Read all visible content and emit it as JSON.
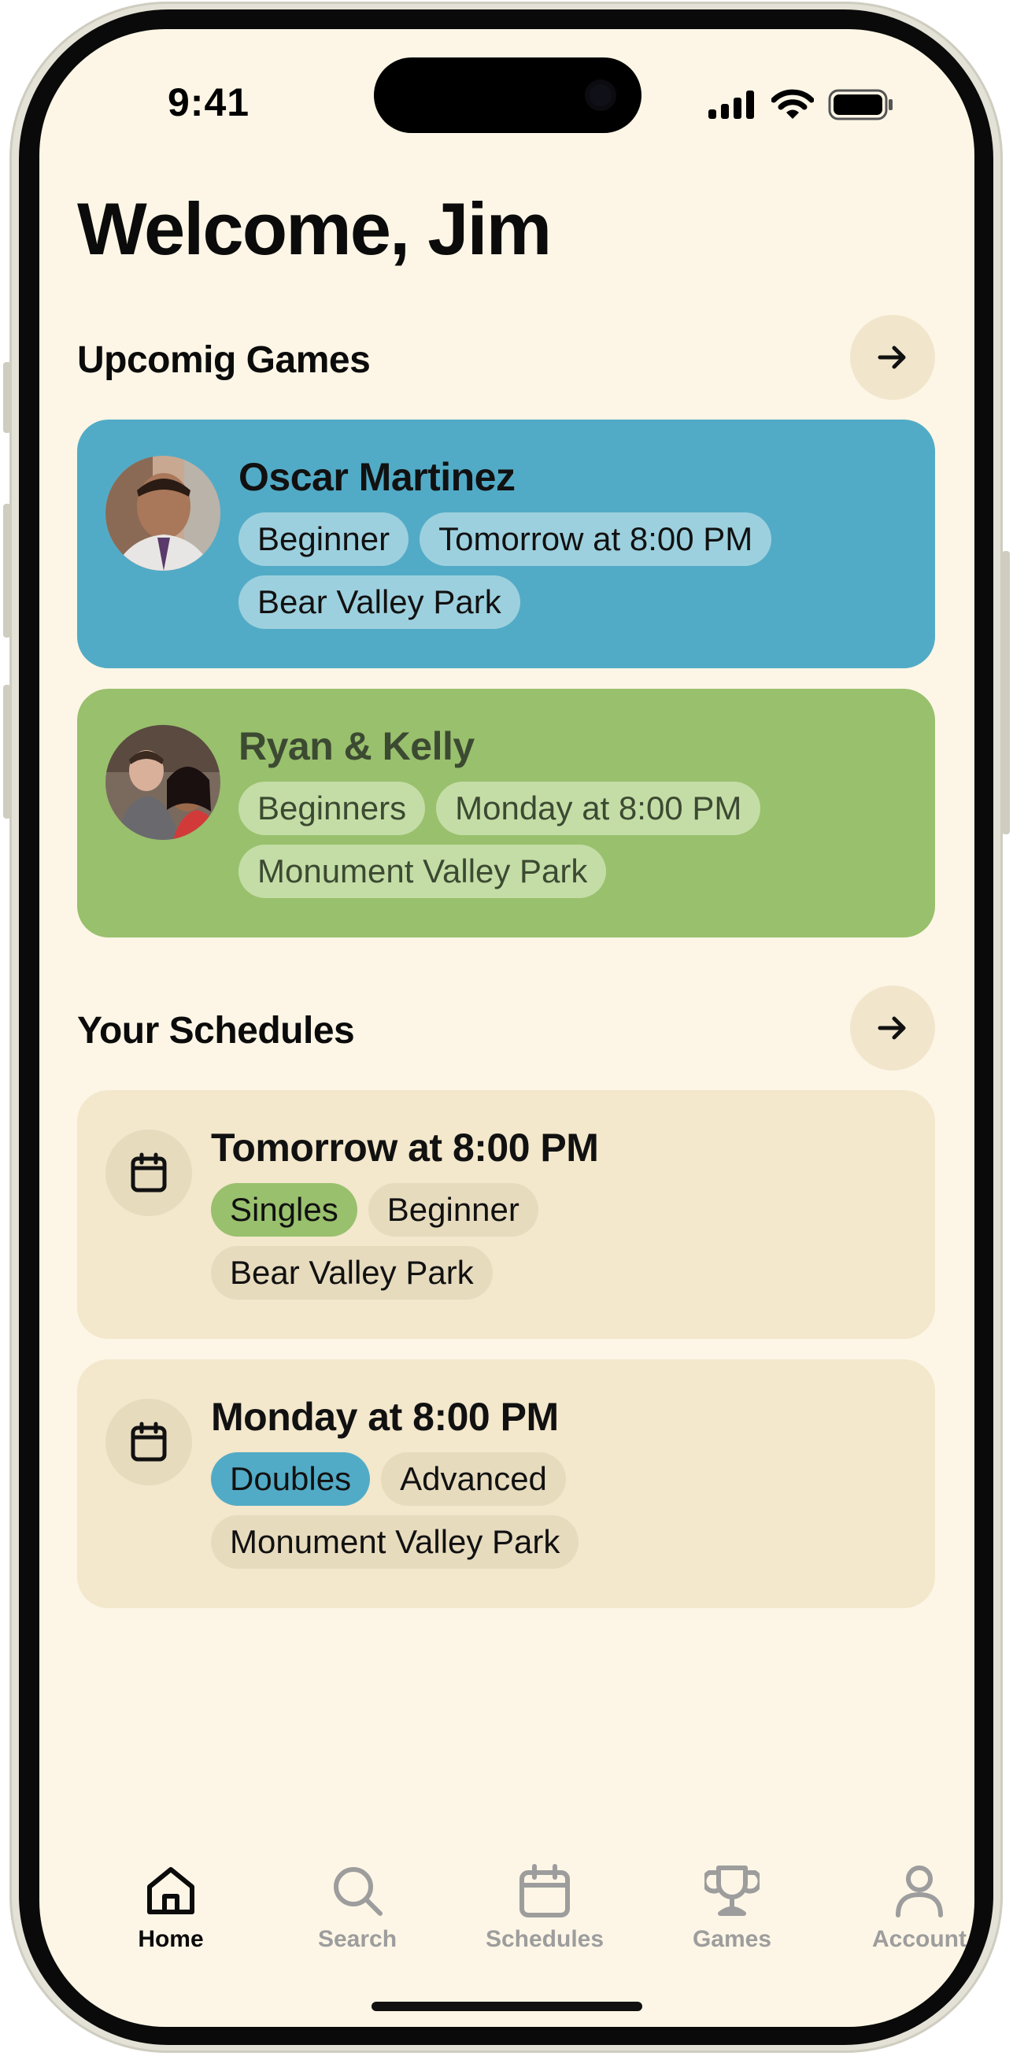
{
  "status_bar": {
    "time": "9:41"
  },
  "header": {
    "title": "Welcome, Jim"
  },
  "upcoming": {
    "title": "Upcomig Games",
    "games": [
      {
        "name": "Oscar Martinez",
        "level": "Beginner",
        "when": "Tomorrow at 8:00 PM",
        "place": "Bear Valley Park",
        "color": "#52abc6"
      },
      {
        "name": "Ryan & Kelly",
        "level": "Beginners",
        "when": "Monday at 8:00 PM",
        "place": "Monument Valley Park",
        "color": "#99c06d"
      }
    ]
  },
  "schedules": {
    "title": "Your Schedules",
    "items": [
      {
        "when": "Tomorrow at 8:00 PM",
        "type": "Singles",
        "level": "Beginner",
        "place": "Bear Valley Park"
      },
      {
        "when": "Monday at 8:00 PM",
        "type": "Doubles",
        "level": "Advanced",
        "place": "Monument Valley Park"
      }
    ]
  },
  "tabbar": {
    "tabs": [
      {
        "label": "Home",
        "icon": "home-icon",
        "active": true
      },
      {
        "label": "Search",
        "icon": "search-icon",
        "active": false
      },
      {
        "label": "Schedules",
        "icon": "calendar-icon",
        "active": false
      },
      {
        "label": "Games",
        "icon": "trophy-icon",
        "active": false
      },
      {
        "label": "Account",
        "icon": "person-icon",
        "active": false
      }
    ]
  },
  "colors": {
    "background": "#fdf6e6",
    "accent_blue": "#52abc6",
    "accent_green": "#99c06d",
    "card_beige": "#f3e7cc"
  }
}
